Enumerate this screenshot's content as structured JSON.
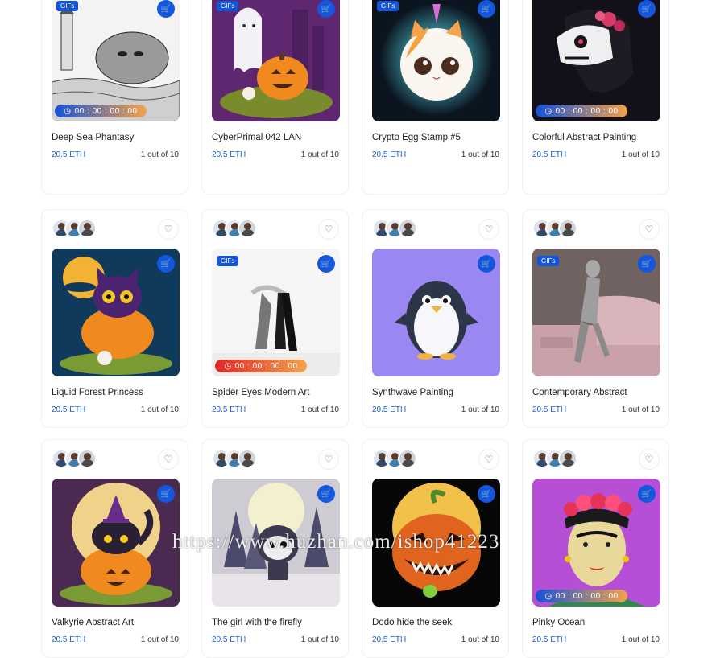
{
  "cards": [
    {
      "title": "Deep Sea Phantasy",
      "price": "20.5 ETH",
      "stock": "1 out of 10",
      "gif": "GIFs",
      "timer": "00 : 00 : 00 : 00",
      "art": "deep-sea",
      "bg": "#f2f2f2"
    },
    {
      "title": "CyberPrimal 042 LAN",
      "price": "20.5 ETH",
      "stock": "1 out of 10",
      "gif": "GIFs",
      "timer": "",
      "art": "ghost-pumpkin",
      "bg": "#5e2770"
    },
    {
      "title": "Crypto Egg Stamp #5",
      "price": "20.5 ETH",
      "stock": "1 out of 10",
      "gif": "GIFs",
      "timer": "",
      "art": "unicorn-cat",
      "bg": "#0b1520"
    },
    {
      "title": "Colorful Abstract Painting",
      "price": "20.5 ETH",
      "stock": "1 out of 10",
      "gif": "",
      "timer": "00 : 00 : 00 : 00",
      "art": "sugar-horse",
      "bg": "#13101a"
    },
    {
      "title": "Liquid Forest Princess",
      "price": "20.5 ETH",
      "stock": "1 out of 10",
      "gif": "",
      "timer": "",
      "art": "cat-pumpkin-night",
      "bg": "#0f3a5c"
    },
    {
      "title": "Spider Eyes Modern Art",
      "price": "20.5 ETH",
      "stock": "1 out of 10",
      "gif": "GIFs",
      "timer": "00 : 00 : 00 : 00",
      "art": "dancer",
      "bg": "#f4f4f4"
    },
    {
      "title": "Synthwave Painting",
      "price": "20.5 ETH",
      "stock": "1 out of 10",
      "gif": "",
      "timer": "",
      "art": "penguin",
      "bg": "#9b87f2"
    },
    {
      "title": "Contemporary Abstract",
      "price": "20.5 ETH",
      "stock": "1 out of 10",
      "gif": "GIFs",
      "timer": "",
      "art": "mannequin",
      "bg": "#7a6a68"
    },
    {
      "title": "Valkyrie Abstract Art",
      "price": "20.5 ETH",
      "stock": "1 out of 10",
      "gif": "",
      "timer": "",
      "art": "witch-cat",
      "bg": "#4b2a52"
    },
    {
      "title": "The girl with the firefly",
      "price": "20.5 ETH",
      "stock": "1 out of 10",
      "gif": "",
      "timer": "",
      "art": "forest-creature",
      "bg": "#cfcbd3"
    },
    {
      "title": "Dodo hide the seek",
      "price": "20.5 ETH",
      "stock": "1 out of 10",
      "gif": "",
      "timer": "",
      "art": "monster-pumpkin",
      "bg": "#070707"
    },
    {
      "title": "Pinky Ocean",
      "price": "20.5 ETH",
      "stock": "1 out of 10",
      "gif": "",
      "timer": "00 : 00 : 00 : 00",
      "art": "frida",
      "bg": "#b64fd6"
    }
  ],
  "icons": {
    "heart": "heart-icon",
    "cart": "cart-icon",
    "clock": "clock-icon"
  },
  "watermark": "https://www.huzhan.com/ishop41223",
  "colors": {
    "accent": "#1356df",
    "price": "#1a5fd9"
  }
}
